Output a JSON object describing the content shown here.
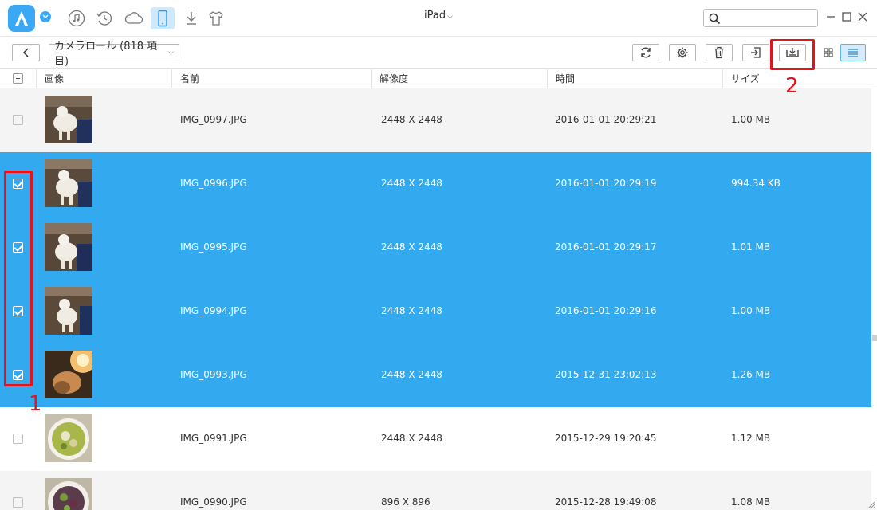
{
  "app": {
    "device_name": "iPad",
    "nav_icons": [
      "music-note-icon",
      "history-icon",
      "cloud-icon",
      "device-icon",
      "download-icon",
      "tshirt-icon"
    ],
    "active_nav": "device-icon",
    "search": {
      "placeholder": "",
      "value": ""
    }
  },
  "toolbar": {
    "album_label": "カメラロール (818 項目)",
    "actions": [
      "refresh-icon",
      "settings-icon",
      "delete-icon",
      "import-to-device-icon",
      "export-to-computer-icon",
      "grid-view-icon",
      "list-view-icon"
    ]
  },
  "table": {
    "columns": {
      "image": "画像",
      "name": "名前",
      "resolution": "解像度",
      "time": "時間",
      "size": "サイズ"
    },
    "rows": [
      {
        "name": "IMG_0997.JPG",
        "resolution": "2448 X 2448",
        "time": "2016-01-01 20:29:21",
        "size": "1.00 MB",
        "selected": false,
        "thumb": "cat"
      },
      {
        "name": "IMG_0996.JPG",
        "resolution": "2448 X 2448",
        "time": "2016-01-01 20:29:19",
        "size": "994.34 KB",
        "selected": true,
        "thumb": "cat"
      },
      {
        "name": "IMG_0995.JPG",
        "resolution": "2448 X 2448",
        "time": "2016-01-01 20:29:17",
        "size": "1.01 MB",
        "selected": true,
        "thumb": "cat"
      },
      {
        "name": "IMG_0994.JPG",
        "resolution": "2448 X 2448",
        "time": "2016-01-01 20:29:16",
        "size": "1.00 MB",
        "selected": true,
        "thumb": "cat"
      },
      {
        "name": "IMG_0993.JPG",
        "resolution": "2448 X 2448",
        "time": "2015-12-31 23:02:13",
        "size": "1.26 MB",
        "selected": true,
        "thumb": "warm"
      },
      {
        "name": "IMG_0991.JPG",
        "resolution": "2448 X 2448",
        "time": "2015-12-29 19:20:45",
        "size": "1.12 MB",
        "selected": false,
        "thumb": "soup"
      },
      {
        "name": "IMG_0990.JPG",
        "resolution": "896 X 896",
        "time": "2015-12-28 19:49:08",
        "size": "1.08 MB",
        "selected": false,
        "thumb": "dish"
      }
    ]
  },
  "annotations": {
    "marker_1": "1",
    "marker_2": "2"
  },
  "colors": {
    "accent": "#33aaf0",
    "selection": "#33aaf0",
    "annotation": "#e5131b"
  }
}
